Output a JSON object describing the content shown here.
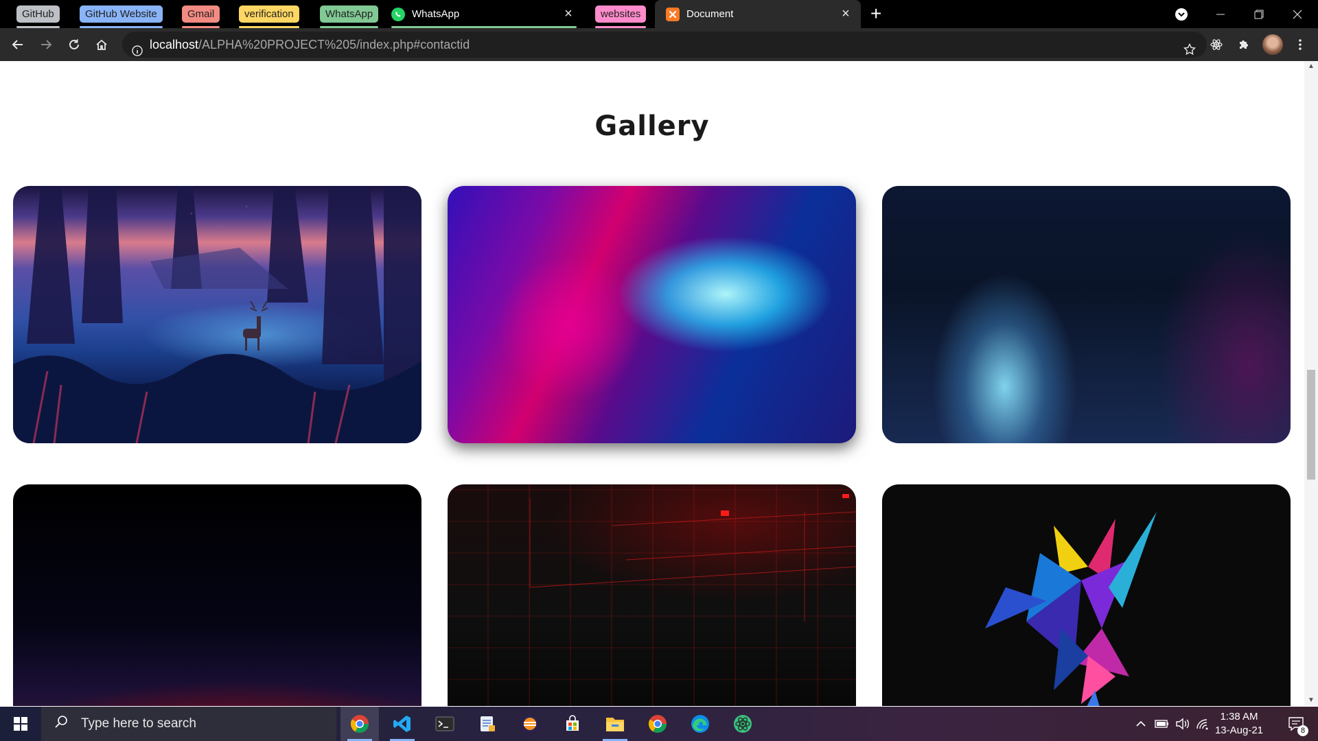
{
  "browser": {
    "tab_groups": [
      {
        "label": "GitHub",
        "color": "#bdc1c6"
      },
      {
        "label": "GitHub Website",
        "color": "#8ab4f8"
      },
      {
        "label": "Gmail",
        "color": "#f28b82"
      },
      {
        "label": "verification",
        "color": "#fdd663"
      },
      {
        "label": "WhatsApp",
        "color": "#81c995"
      },
      {
        "label": "websites",
        "color": "#ff8bcb"
      }
    ],
    "tabs": [
      {
        "title": "WhatsApp"
      },
      {
        "title": "Document"
      }
    ],
    "address": {
      "host": "localhost",
      "path": "/ALPHA%20PROJECT%205/index.php#contactid"
    }
  },
  "page": {
    "section_title": "Gallery",
    "cards": [
      {
        "image": "forest-deer"
      },
      {
        "image": "aurora-gradient"
      },
      {
        "image": "blue-glow"
      },
      {
        "image": "dark-red-horizon"
      },
      {
        "image": "red-circuit"
      },
      {
        "image": "abstract-shard"
      }
    ]
  },
  "taskbar": {
    "search_placeholder": "Type here to search",
    "time": "1:38 AM",
    "date": "13-Aug-21",
    "notifications": "8"
  },
  "colors": {
    "accent_button": "#129aff",
    "tab_strip": "#000000",
    "toolbar": "#2b2b2b"
  }
}
